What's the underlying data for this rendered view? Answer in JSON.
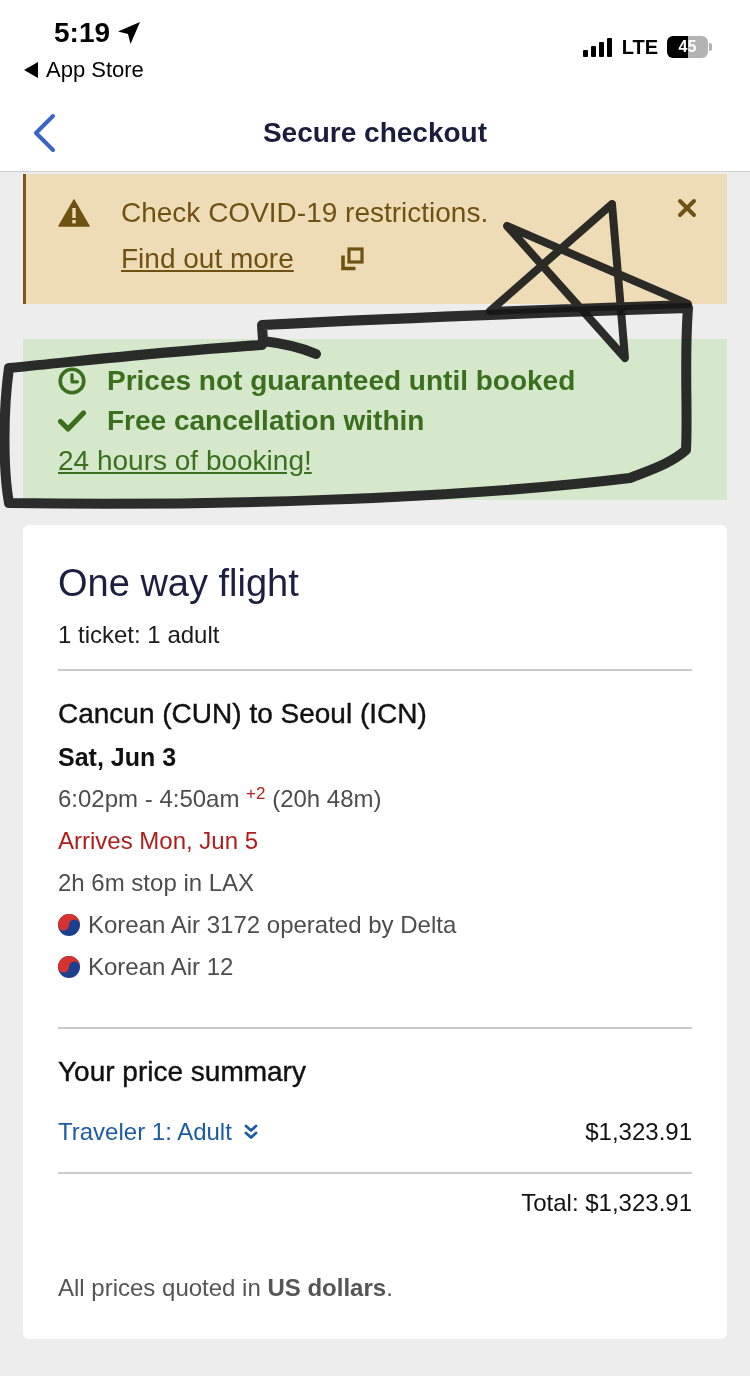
{
  "status_bar": {
    "time": "5:19",
    "back_app": "App Store",
    "network": "LTE",
    "battery": "45"
  },
  "header": {
    "title": "Secure checkout"
  },
  "covid_alert": {
    "message": "Check COVID-19 restrictions.",
    "link": "Find out more"
  },
  "info_banner": {
    "items": [
      {
        "kind": "clock",
        "text": "Prices not guaranteed until booked"
      },
      {
        "kind": "check",
        "text": "Free cancellation within",
        "link": "24 hours of booking!"
      }
    ]
  },
  "flight_card": {
    "title": "One way flight",
    "tickets": "1 ticket: 1 adult",
    "route": "Cancun (CUN) to Seoul (ICN)",
    "date": "Sat, Jun 3",
    "times": "6:02pm - 4:50am $^{+2}$ (20h 48m)",
    "arrival": "Arrives Mon, Jun 5",
    "stop": "2h 6m stop in LAX",
    "flights": [
      "Korean Air 3172 operated by Delta",
      "Korean Air 12"
    ]
  },
  "price_summary": {
    "title": "Your price summary",
    "rows": [
      {
        "label": "Traveler 1: Adult",
        "amount": "$1,323.91"
      }
    ],
    "total": "Total: $1,323.91",
    "note": "All prices quoted in **US dollars**."
  }
}
